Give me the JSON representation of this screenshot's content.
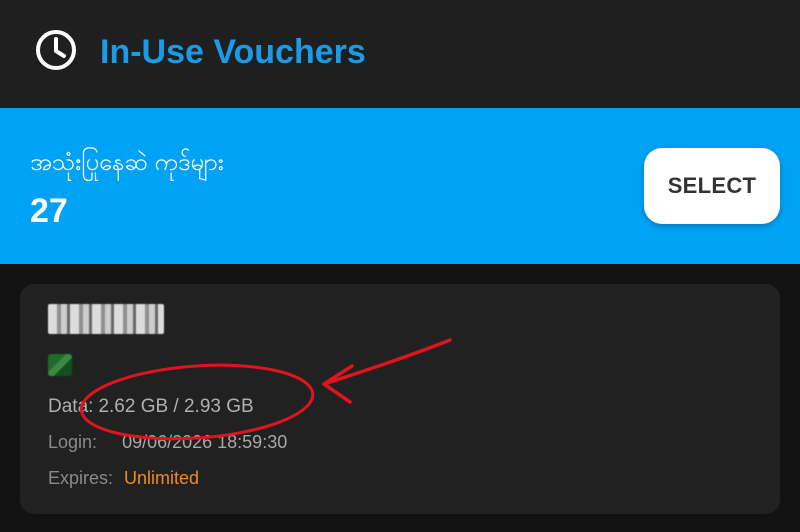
{
  "header": {
    "title": "In-Use Vouchers",
    "icon": "clock-icon",
    "title_color": "#1a9be6"
  },
  "banner": {
    "label": "အသုံးပြုနေဆဲ ကုဒ်များ",
    "count": "27",
    "select_label": "SELECT",
    "color": "#00a2f5"
  },
  "voucher": {
    "data_label": "Data:",
    "data_value": "2.62 GB / 2.93 GB",
    "login_label": "Login:",
    "login_value": "09/06/2026 18:59:30",
    "expires_label": "Expires:",
    "expires_value": "Unlimited",
    "expires_color": "#f08c1e"
  },
  "annotation": {
    "color": "#e0141e"
  }
}
